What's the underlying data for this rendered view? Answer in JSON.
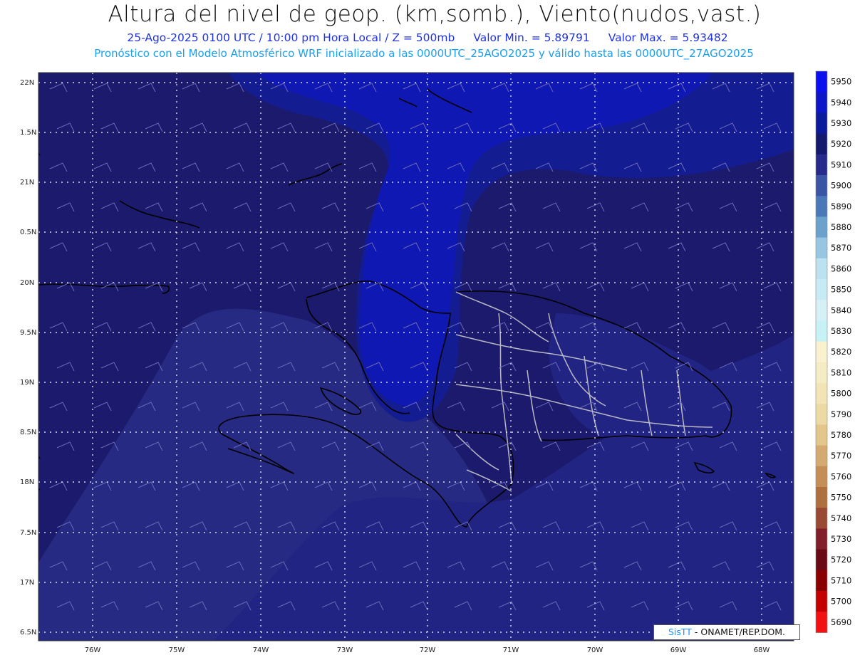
{
  "header": {
    "title": "Altura del nivel de geop. (km,somb.), Viento(nudos,vast.)",
    "date_line": "25-Ago-2025  0100 UTC / 10:00 pm Hora Local / Z = 500mb",
    "min_label": "Valor Min. = 5.89791",
    "max_label": "Valor Max. = 5.93482",
    "model_line": "Pronóstico con el Modelo Atmosférico WRF inicializado a las 0000UTC_25AGO2025 y válido hasta las  0000UTC_27AGO2025"
  },
  "axes": {
    "lat_labels": [
      "22N",
      "1.5N",
      "21N",
      "0.5N",
      "20N",
      "9.5N",
      "19N",
      "8.5N",
      "18N",
      "7.5N",
      "17N",
      "6.5N"
    ],
    "lon_labels": [
      "76W",
      "75W",
      "74W",
      "73W",
      "72W",
      "71W",
      "70W",
      "69W",
      "68W"
    ]
  },
  "colorbar": {
    "levels": [
      5950,
      5940,
      5930,
      5920,
      5910,
      5900,
      5890,
      5880,
      5870,
      5860,
      5850,
      5840,
      5830,
      5820,
      5810,
      5800,
      5790,
      5780,
      5770,
      5760,
      5750,
      5740,
      5730,
      5720,
      5710,
      5700,
      5690
    ],
    "colors": [
      "#0a10f0",
      "#0c16c8",
      "#0c1a9c",
      "#141a6e",
      "#262a8a",
      "#3a54a6",
      "#4a78b8",
      "#6aa2cc",
      "#96c6e2",
      "#bce2f0",
      "#c8eaf4",
      "#d6f0f8",
      "#c6f2f6",
      "#f8f2d0",
      "#f6ecc4",
      "#f2e4b4",
      "#ecdaa4",
      "#e2c68c",
      "#d4aa70",
      "#c48e56",
      "#b0703e",
      "#9a4a32",
      "#82202a",
      "#6a0a14",
      "#8a0000",
      "#c40000",
      "#f21212"
    ]
  },
  "field": {
    "background": "#1c1a6c",
    "high_center": "#1018b4",
    "high_center_mid": "#141c92",
    "low_southwest": "#262a82",
    "low_south": "#222484"
  },
  "credit": {
    "brand": "SisTT",
    "text": " - ONAMET/REP.DOM."
  }
}
